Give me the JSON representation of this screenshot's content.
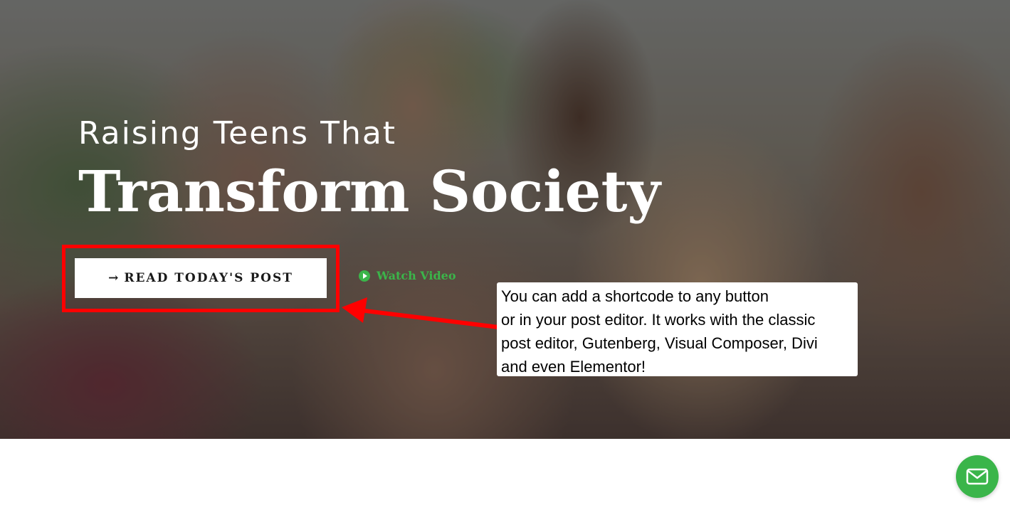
{
  "hero": {
    "subtitle": "Raising Teens That",
    "title": "Transform Society"
  },
  "cta": {
    "read_button_arrow": "→",
    "read_button_label": "READ TODAY'S POST",
    "watch_video_label": "Watch Video"
  },
  "annotation": {
    "lines": [
      "You can add a shortcode to any button",
      "or in your post editor. It works with the classic",
      "post editor, Gutenberg, Visual Composer, Divi",
      "and even Elementor!"
    ]
  },
  "icons": {
    "play": "play-circle-icon",
    "mail": "envelope-icon",
    "arrow": "arrow-right-icon"
  },
  "colors": {
    "highlight": "#ff0000",
    "accent_green": "#3bb54a",
    "button_bg": "#ffffff",
    "hero_text": "#ffffff"
  }
}
